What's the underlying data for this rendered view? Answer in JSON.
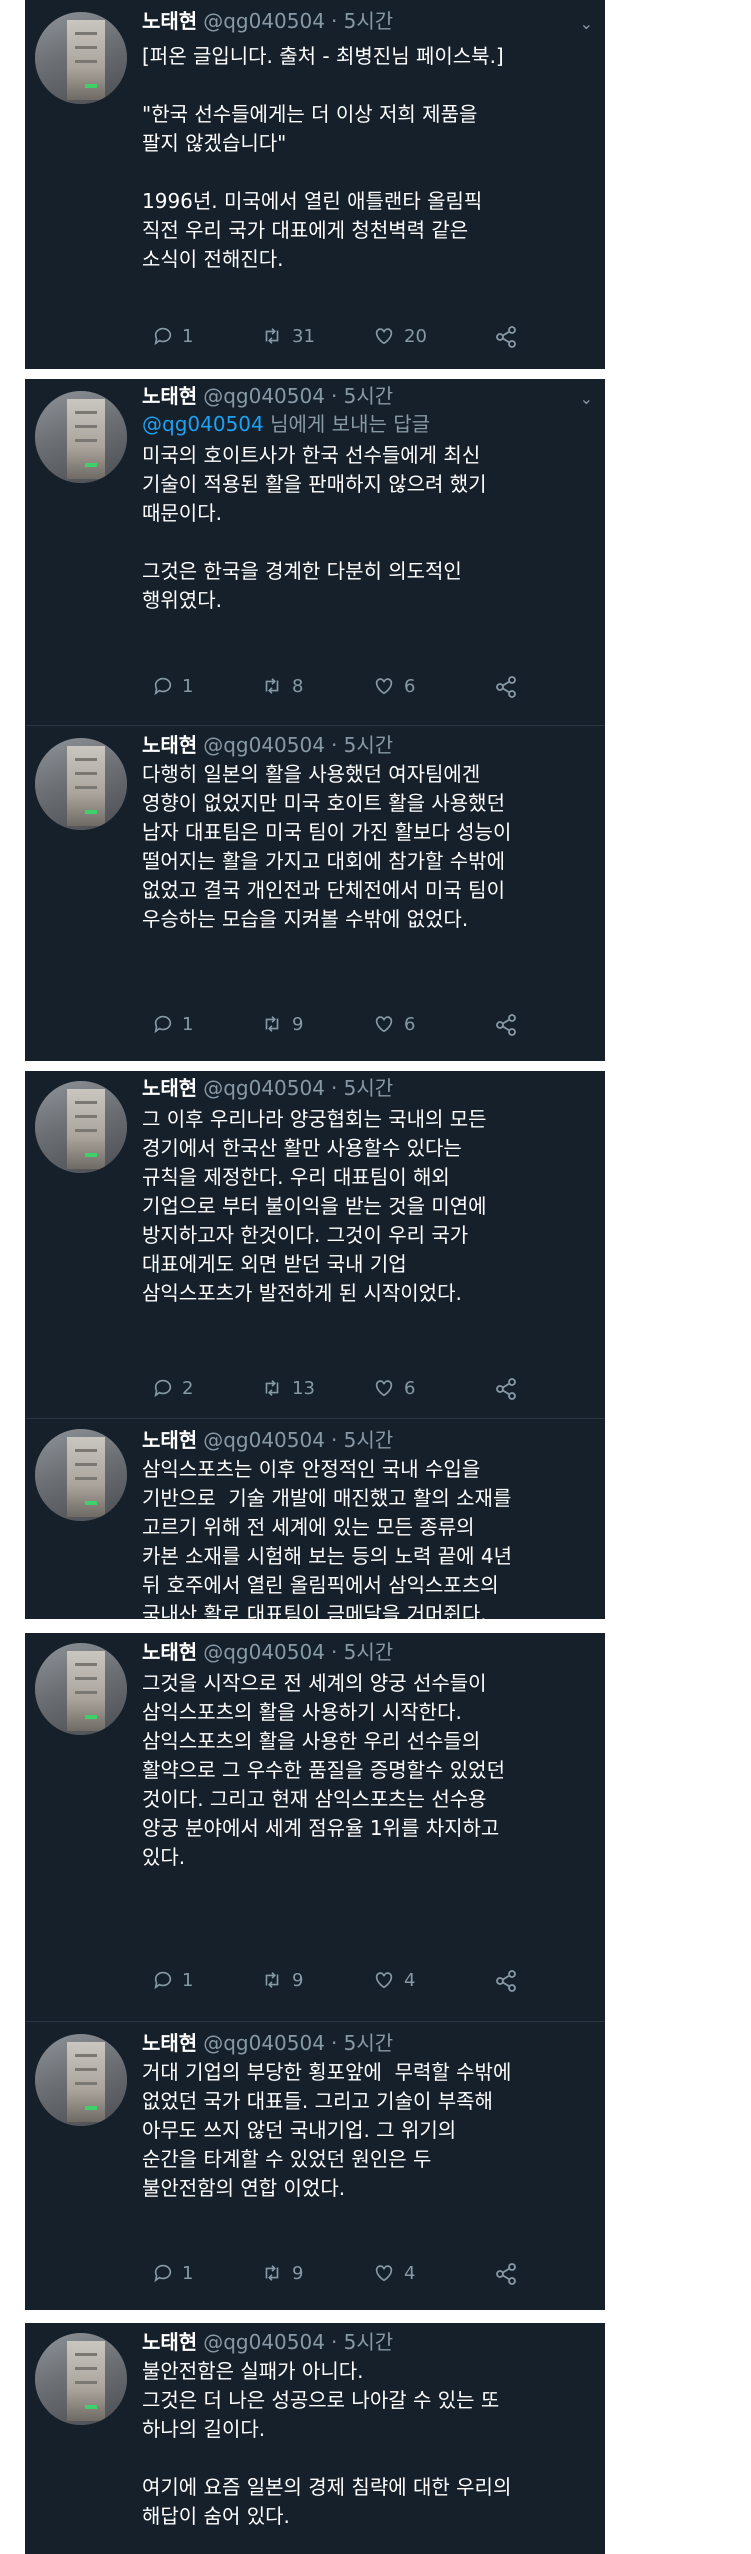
{
  "user": {
    "name": "노태현",
    "handle": "@qg040504",
    "time": "· 5시간"
  },
  "icons": {
    "reply": "comment-icon",
    "retweet": "retweet-icon",
    "like": "heart-icon",
    "share": "share-icon",
    "menu": "chevron-down-icon"
  },
  "colors": {
    "background": "#15202b",
    "text": "#ffffff",
    "muted": "#8899a6",
    "link": "#1da1f2"
  },
  "tweets": [
    {
      "text": "[퍼온 글입니다. 출처 - 최병진님 페이스북.]\n\n\"한국 선수들에게는 더 이상 저희 제품을\n팔지 않겠습니다\"\n\n1996년. 미국에서 열린 애틀랜타 올림픽\n직전 우리 국가 대표에게 청천벽력 같은\n소식이 전해진다.",
      "replies": "1",
      "retweets": "31",
      "likes": "20"
    },
    {
      "reply_prefix": "@qg040504",
      "reply_suffix": "님에게 보내는 답글",
      "text": "미국의 호이트사가 한국 선수들에게 최신\n기술이 적용된 활을 판매하지 않으려 했기\n때문이다.\n\n그것은 한국을 경계한 다분히 의도적인\n행위였다.",
      "replies": "1",
      "retweets": "8",
      "likes": "6"
    },
    {
      "text": "다행히 일본의 활을 사용했던 여자팀에겐\n영향이 없었지만 미국 호이트 활을 사용했던\n남자 대표팀은 미국 팀이 가진 활보다 성능이\n떨어지는 활을 가지고 대회에 참가할 수밖에\n없었고 결국 개인전과 단체전에서 미국 팀이\n우승하는 모습을 지켜볼 수밖에 없었다.",
      "replies": "1",
      "retweets": "9",
      "likes": "6"
    },
    {
      "text": "그 이후 우리나라 양궁협회는 국내의 모든\n경기에서 한국산 활만 사용할수 있다는\n규칙을 제정한다. 우리 대표팀이 해외\n기업으로 부터 불이익을 받는 것을 미연에\n방지하고자 한것이다. 그것이 우리 국가\n대표에게도 외면 받던 국내 기업\n삼익스포츠가 발전하게 된 시작이었다.",
      "replies": "2",
      "retweets": "13",
      "likes": "6"
    },
    {
      "text": "삼익스포츠는 이후 안정적인 국내 수입을\n기반으로  기술 개발에 매진했고 활의 소재를\n고르기 위해 전 세계에 있는 모든 종류의\n카본 소재를 시험해 보는 등의 노력 끝에 4년\n뒤 호주에서 열린 올림픽에서 삼익스포츠의\n국내산 활로 대표팀이 금메달을 거머쥔다."
    },
    {
      "text": "그것을 시작으로 전 세계의 양궁 선수들이\n삼익스포츠의 활을 사용하기 시작한다.\n삼익스포츠의 활을 사용한 우리 선수들의\n활약으로 그 우수한 품질을 증명할수 있었던\n것이다. 그리고 현재 삼익스포츠는 선수용\n양궁 분야에서 세계 점유율 1위를 차지하고\n있다.",
      "replies": "1",
      "retweets": "9",
      "likes": "4"
    },
    {
      "text": "거대 기업의 부당한 횡포앞에  무력할 수밖에\n없었던 국가 대표들. 그리고 기술이 부족해\n아무도 쓰지 않던 국내기업. 그 위기의\n순간을 타계할 수 있었던 원인은 두\n불안전함의 연합 이었다.",
      "replies": "1",
      "retweets": "9",
      "likes": "4"
    },
    {
      "text": "불안전함은 실패가 아니다.\n그것은 더 나은 성공으로 나아갈 수 있는 또\n하나의 길이다.\n\n여기에 요즘 일본의 경제 침략에 대한 우리의\n해답이 숨어 있다."
    }
  ]
}
